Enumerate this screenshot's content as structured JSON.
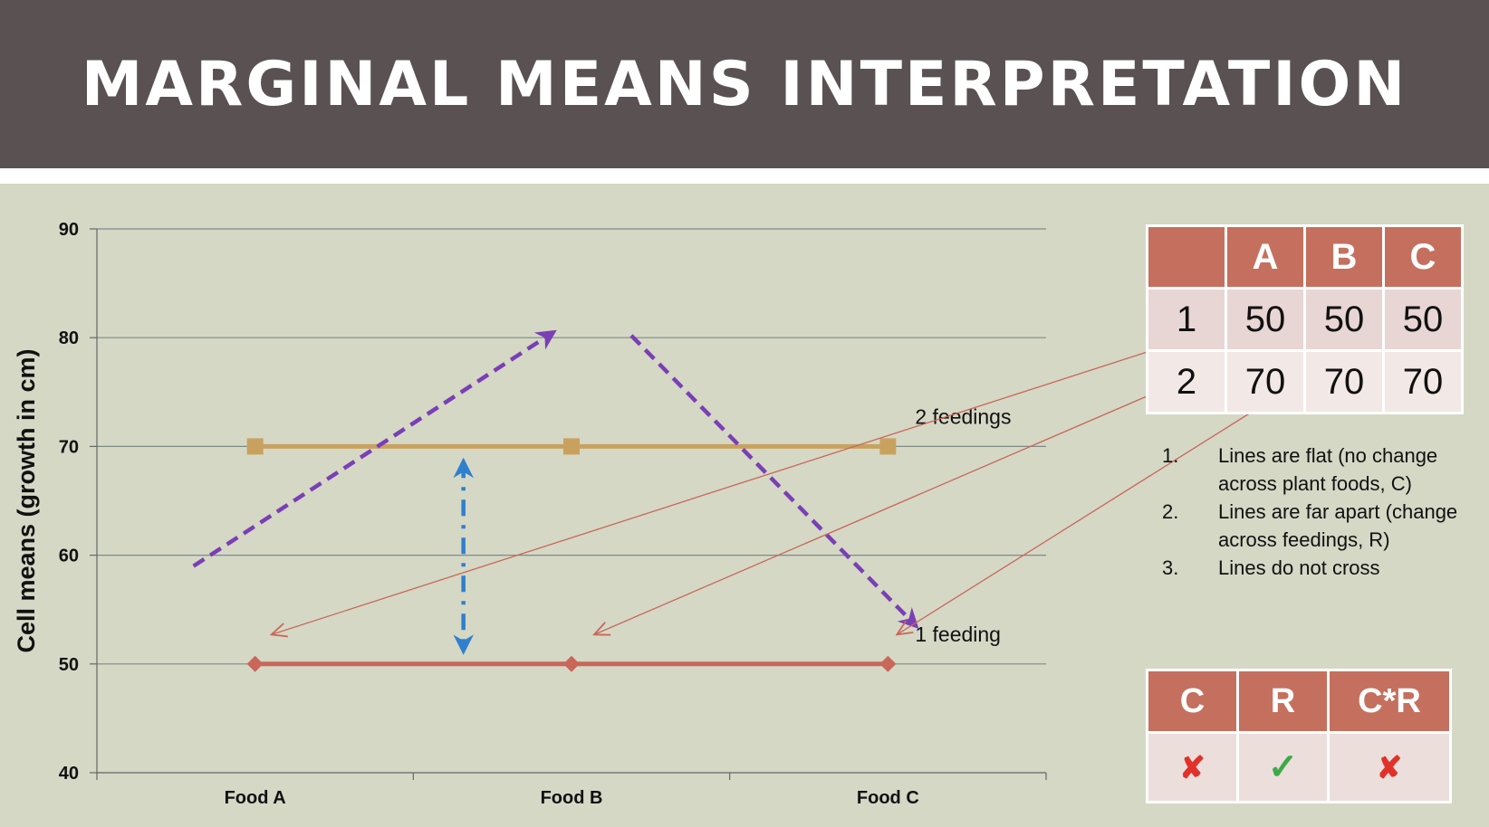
{
  "slide": {
    "title": "MARGINAL MEANS INTERPRETATION"
  },
  "chart_data": {
    "type": "line",
    "categories": [
      "Food A",
      "Food B",
      "Food C"
    ],
    "series": [
      {
        "name": "2 feedings",
        "values": [
          70,
          70,
          70
        ],
        "color": "#c9a15e",
        "marker": "square"
      },
      {
        "name": "1 feeding",
        "values": [
          50,
          50,
          50
        ],
        "color": "#c8675a",
        "marker": "diamond"
      }
    ],
    "ylabel": "Cell means (growth in cm)",
    "ylim": [
      40,
      90
    ],
    "yticks": [
      40,
      50,
      60,
      70,
      80,
      90
    ],
    "grid": true,
    "annotations": {
      "purple_dashed_arrows": "up-then-down across foods (C effect)",
      "blue_dash_dot_arrow": "double-headed between series (R effect)",
      "colors": {
        "purple": "#7a3fb5",
        "blue": "#2f7fcf",
        "pointer": "#c8675a"
      }
    }
  },
  "means_table": {
    "header": [
      "",
      "A",
      "B",
      "C"
    ],
    "rows": [
      {
        "label": "1",
        "values": [
          "50",
          "50",
          "50"
        ]
      },
      {
        "label": "2",
        "values": [
          "70",
          "70",
          "70"
        ]
      }
    ]
  },
  "notes": [
    {
      "num": "1.",
      "text": "Lines are flat (no change across plant foods, C)"
    },
    {
      "num": "2.",
      "text": "Lines are far apart (change across feedings, R)"
    },
    {
      "num": "3.",
      "text": "Lines do not cross"
    }
  ],
  "effects_table": {
    "header": [
      "C",
      "R",
      "C*R"
    ],
    "results": [
      "✘",
      "✓",
      "✘"
    ],
    "result_icons": [
      "x-mark-icon",
      "check-mark-icon",
      "x-mark-icon"
    ]
  },
  "colors": {
    "title_bar": "#5a5152",
    "content_bg": "#d5d8c5",
    "table_header": "#c5705e"
  }
}
